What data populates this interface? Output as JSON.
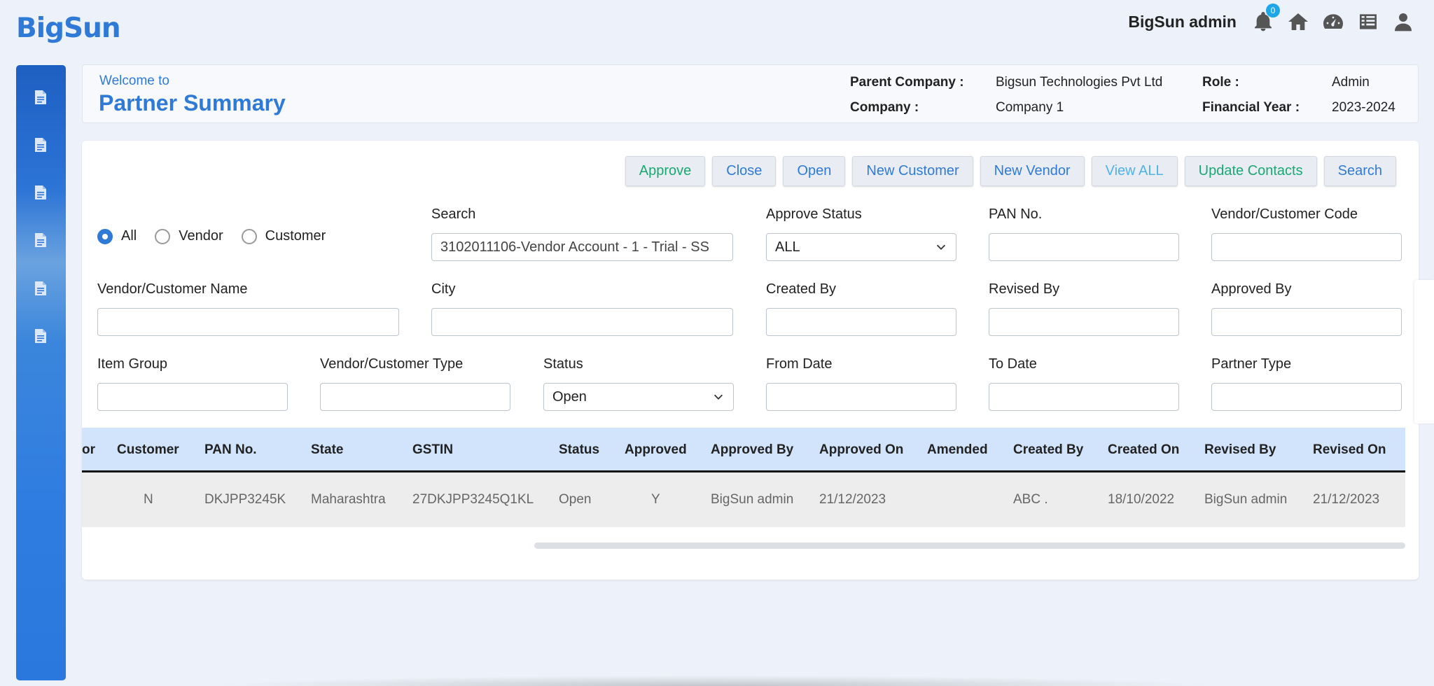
{
  "app": {
    "logo": "BigSun"
  },
  "topbar": {
    "user_name": "BigSun admin",
    "notification_count": "0",
    "icons": [
      "bell-icon",
      "home-icon",
      "dashboard-icon",
      "list-icon",
      "user-icon"
    ]
  },
  "sidebar": {
    "items": [
      {
        "icon": "document-icon"
      },
      {
        "icon": "document-icon"
      },
      {
        "icon": "document-icon"
      },
      {
        "icon": "document-icon"
      },
      {
        "icon": "document-icon"
      },
      {
        "icon": "document-icon"
      }
    ]
  },
  "header": {
    "welcome": "Welcome to",
    "title": "Partner Summary",
    "parent_company_label": "Parent Company :",
    "parent_company_value": "Bigsun Technologies Pvt Ltd",
    "company_label": "Company :",
    "company_value": "Company 1",
    "role_label": "Role :",
    "role_value": "Admin",
    "fy_label": "Financial Year :",
    "fy_value": "2023-2024"
  },
  "actions": {
    "approve": "Approve",
    "close": "Close",
    "open": "Open",
    "new_customer": "New Customer",
    "new_vendor": "New Vendor",
    "view_all": "View ALL",
    "update_contacts": "Update Contacts",
    "search": "Search"
  },
  "filter_type": {
    "options": [
      "All",
      "Vendor",
      "Customer"
    ],
    "selected": "All"
  },
  "filters": {
    "search": {
      "label": "Search",
      "value": "3102011106-Vendor Account - 1 - Trial - SS"
    },
    "approve_status": {
      "label": "Approve Status",
      "value": "ALL"
    },
    "pan_no": {
      "label": "PAN No.",
      "value": ""
    },
    "code": {
      "label": "Vendor/Customer Code",
      "value": ""
    },
    "name": {
      "label": "Vendor/Customer Name",
      "value": ""
    },
    "city": {
      "label": "City",
      "value": ""
    },
    "created_by": {
      "label": "Created By",
      "value": ""
    },
    "revised_by": {
      "label": "Revised By",
      "value": ""
    },
    "approved_by": {
      "label": "Approved By",
      "value": ""
    },
    "item_group": {
      "label": "Item Group",
      "value": ""
    },
    "type": {
      "label": "Vendor/Customer Type",
      "value": ""
    },
    "status": {
      "label": "Status",
      "value": "Open"
    },
    "from_date": {
      "label": "From Date",
      "value": ""
    },
    "to_date": {
      "label": "To Date",
      "value": ""
    },
    "partner_type": {
      "label": "Partner Type",
      "value": ""
    }
  },
  "table": {
    "columns": [
      "or",
      "Customer",
      "PAN No.",
      "State",
      "GSTIN",
      "Status",
      "Approved",
      "Approved By",
      "Approved On",
      "Amended",
      "Created By",
      "Created On",
      "Revised By",
      "Revised On"
    ],
    "rows": [
      [
        "",
        "N",
        "DKJPP3245K",
        "Maharashtra",
        "27DKJPP3245Q1KL",
        "Open",
        "Y",
        "BigSun admin",
        "21/12/2023",
        "",
        "ABC .",
        "18/10/2022",
        "BigSun admin",
        "21/12/2023"
      ]
    ]
  }
}
